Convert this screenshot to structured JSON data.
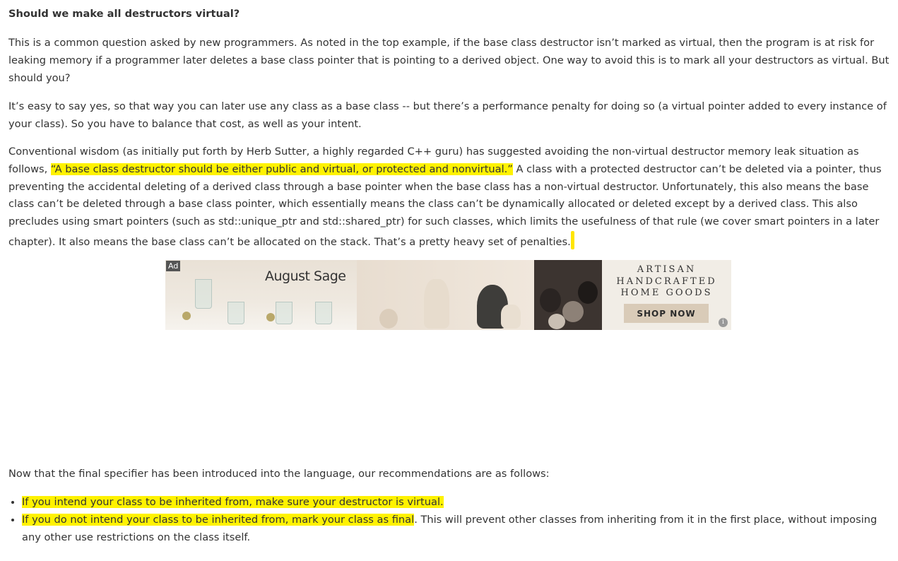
{
  "heading": "Should we make all destructors virtual?",
  "p1": "This is a common question asked by new programmers. As noted in the top example, if the base class destructor isn’t marked as virtual, then the program is at risk for leaking memory if a programmer later deletes a base class pointer that is pointing to a derived object. One way to avoid this is to mark all your destructors as virtual. But should you?",
  "p2": "It’s easy to say yes, so that way you can later use any class as a base class -- but there’s a performance penalty for doing so (a virtual pointer added to every instance of your class). So you have to balance that cost, as well as your intent.",
  "p3": {
    "before": "Conventional wisdom (as initially put forth by Herb Sutter, a highly regarded C++ guru) has suggested avoiding the non-virtual destructor memory leak situation as follows, ",
    "quote": "“A base class destructor should be either public and virtual, or protected and nonvirtual.”",
    "after": " A class with a protected destructor can’t be deleted via a pointer, thus preventing the accidental deleting of a derived class through a base pointer when the base class has a non-virtual destructor. Unfortunately, this also means the base class can’t be deleted through a base class pointer, which essentially means the class can’t be dynamically allocated or deleted except by a derived class. This also precludes using smart pointers (such as std::unique_ptr and std::shared_ptr) for such classes, which limits the usefulness of that rule (we cover smart pointers in a later chapter). It also means the base class can’t be allocated on the stack. That’s a pretty heavy set of penalties."
  },
  "ad": {
    "label": "Ad",
    "brand": "August Sage",
    "headline_1": "ARTISAN",
    "headline_2": "HANDCRAFTED",
    "headline_3": "HOME GOODS",
    "cta": "SHOP NOW",
    "info": "i"
  },
  "p4": "Now that the final specifier has been introduced into the language, our recommendations are as follows:",
  "bullets": {
    "b1": "If you intend your class to be inherited from, make sure your destructor is virtual.",
    "b2_hl": "If you do not intend your class to be inherited from, mark your class as final",
    "b2_rest": ". This will prevent other classes from inheriting from it in the first place, without imposing any other use restrictions on the class itself."
  },
  "colors": {
    "highlight": "#fff200",
    "text": "#333333"
  }
}
